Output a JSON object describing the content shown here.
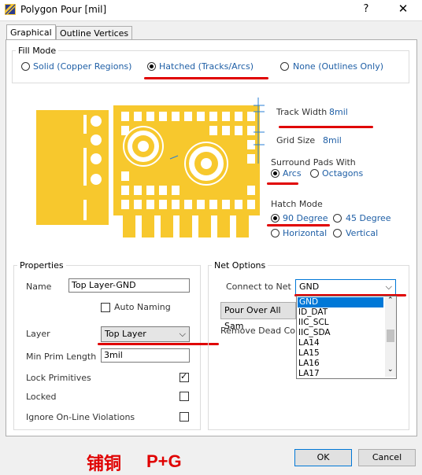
{
  "window": {
    "title": "Polygon Pour [mil]",
    "help": "?",
    "close": "✕"
  },
  "tabs": [
    {
      "label": "Graphical"
    },
    {
      "label": "Outline Vertices"
    }
  ],
  "fill_mode": {
    "title": "Fill Mode",
    "options": [
      {
        "label": "Solid (Copper Regions)",
        "selected": false
      },
      {
        "label": "Hatched (Tracks/Arcs)",
        "selected": true
      },
      {
        "label": "None (Outlines Only)",
        "selected": false
      }
    ]
  },
  "params": {
    "track_width_label": "Track Width",
    "track_width_value": "8mil",
    "grid_size_label": "Grid Size",
    "grid_size_value": "8mil",
    "surround_label": "Surround Pads With",
    "surround_options": [
      {
        "label": "Arcs",
        "selected": true
      },
      {
        "label": "Octagons",
        "selected": false
      }
    ],
    "hatch_label": "Hatch Mode",
    "hatch_options": [
      {
        "label": "90 Degree",
        "selected": true
      },
      {
        "label": "45 Degree",
        "selected": false
      },
      {
        "label": "Horizontal",
        "selected": false
      },
      {
        "label": "Vertical",
        "selected": false
      }
    ]
  },
  "properties": {
    "title": "Properties",
    "name_label": "Name",
    "name_value": "Top Layer-GND",
    "auto_naming_label": "Auto Naming",
    "auto_naming_checked": false,
    "layer_label": "Layer",
    "layer_value": "Top Layer",
    "min_prim_label": "Min Prim Length",
    "min_prim_value": "3mil",
    "lock_primitives_label": "Lock Primitives",
    "lock_primitives_checked": true,
    "locked_label": "Locked",
    "locked_checked": false,
    "ignore_label": "Ignore On-Line Violations",
    "ignore_checked": false
  },
  "net_options": {
    "title": "Net Options",
    "connect_label": "Connect to Net",
    "connect_value": "GND",
    "pour_over_label": "Pour Over All Sam",
    "remove_dead_label": "Remove Dead Cop",
    "dropdown_items": [
      "GND",
      "ID_DAT",
      "IIC_SCL",
      "IIC_SDA",
      "LA14",
      "LA15",
      "LA16",
      "LA17"
    ],
    "dropdown_selected": "GND"
  },
  "footer": {
    "annotation": "铺铜",
    "shortcut": "P+G",
    "ok_label": "OK",
    "cancel_label": "Cancel"
  },
  "colors": {
    "copper": "#f7c82d",
    "annotation": "#e00000",
    "link_blue": "#1f5fa6"
  }
}
